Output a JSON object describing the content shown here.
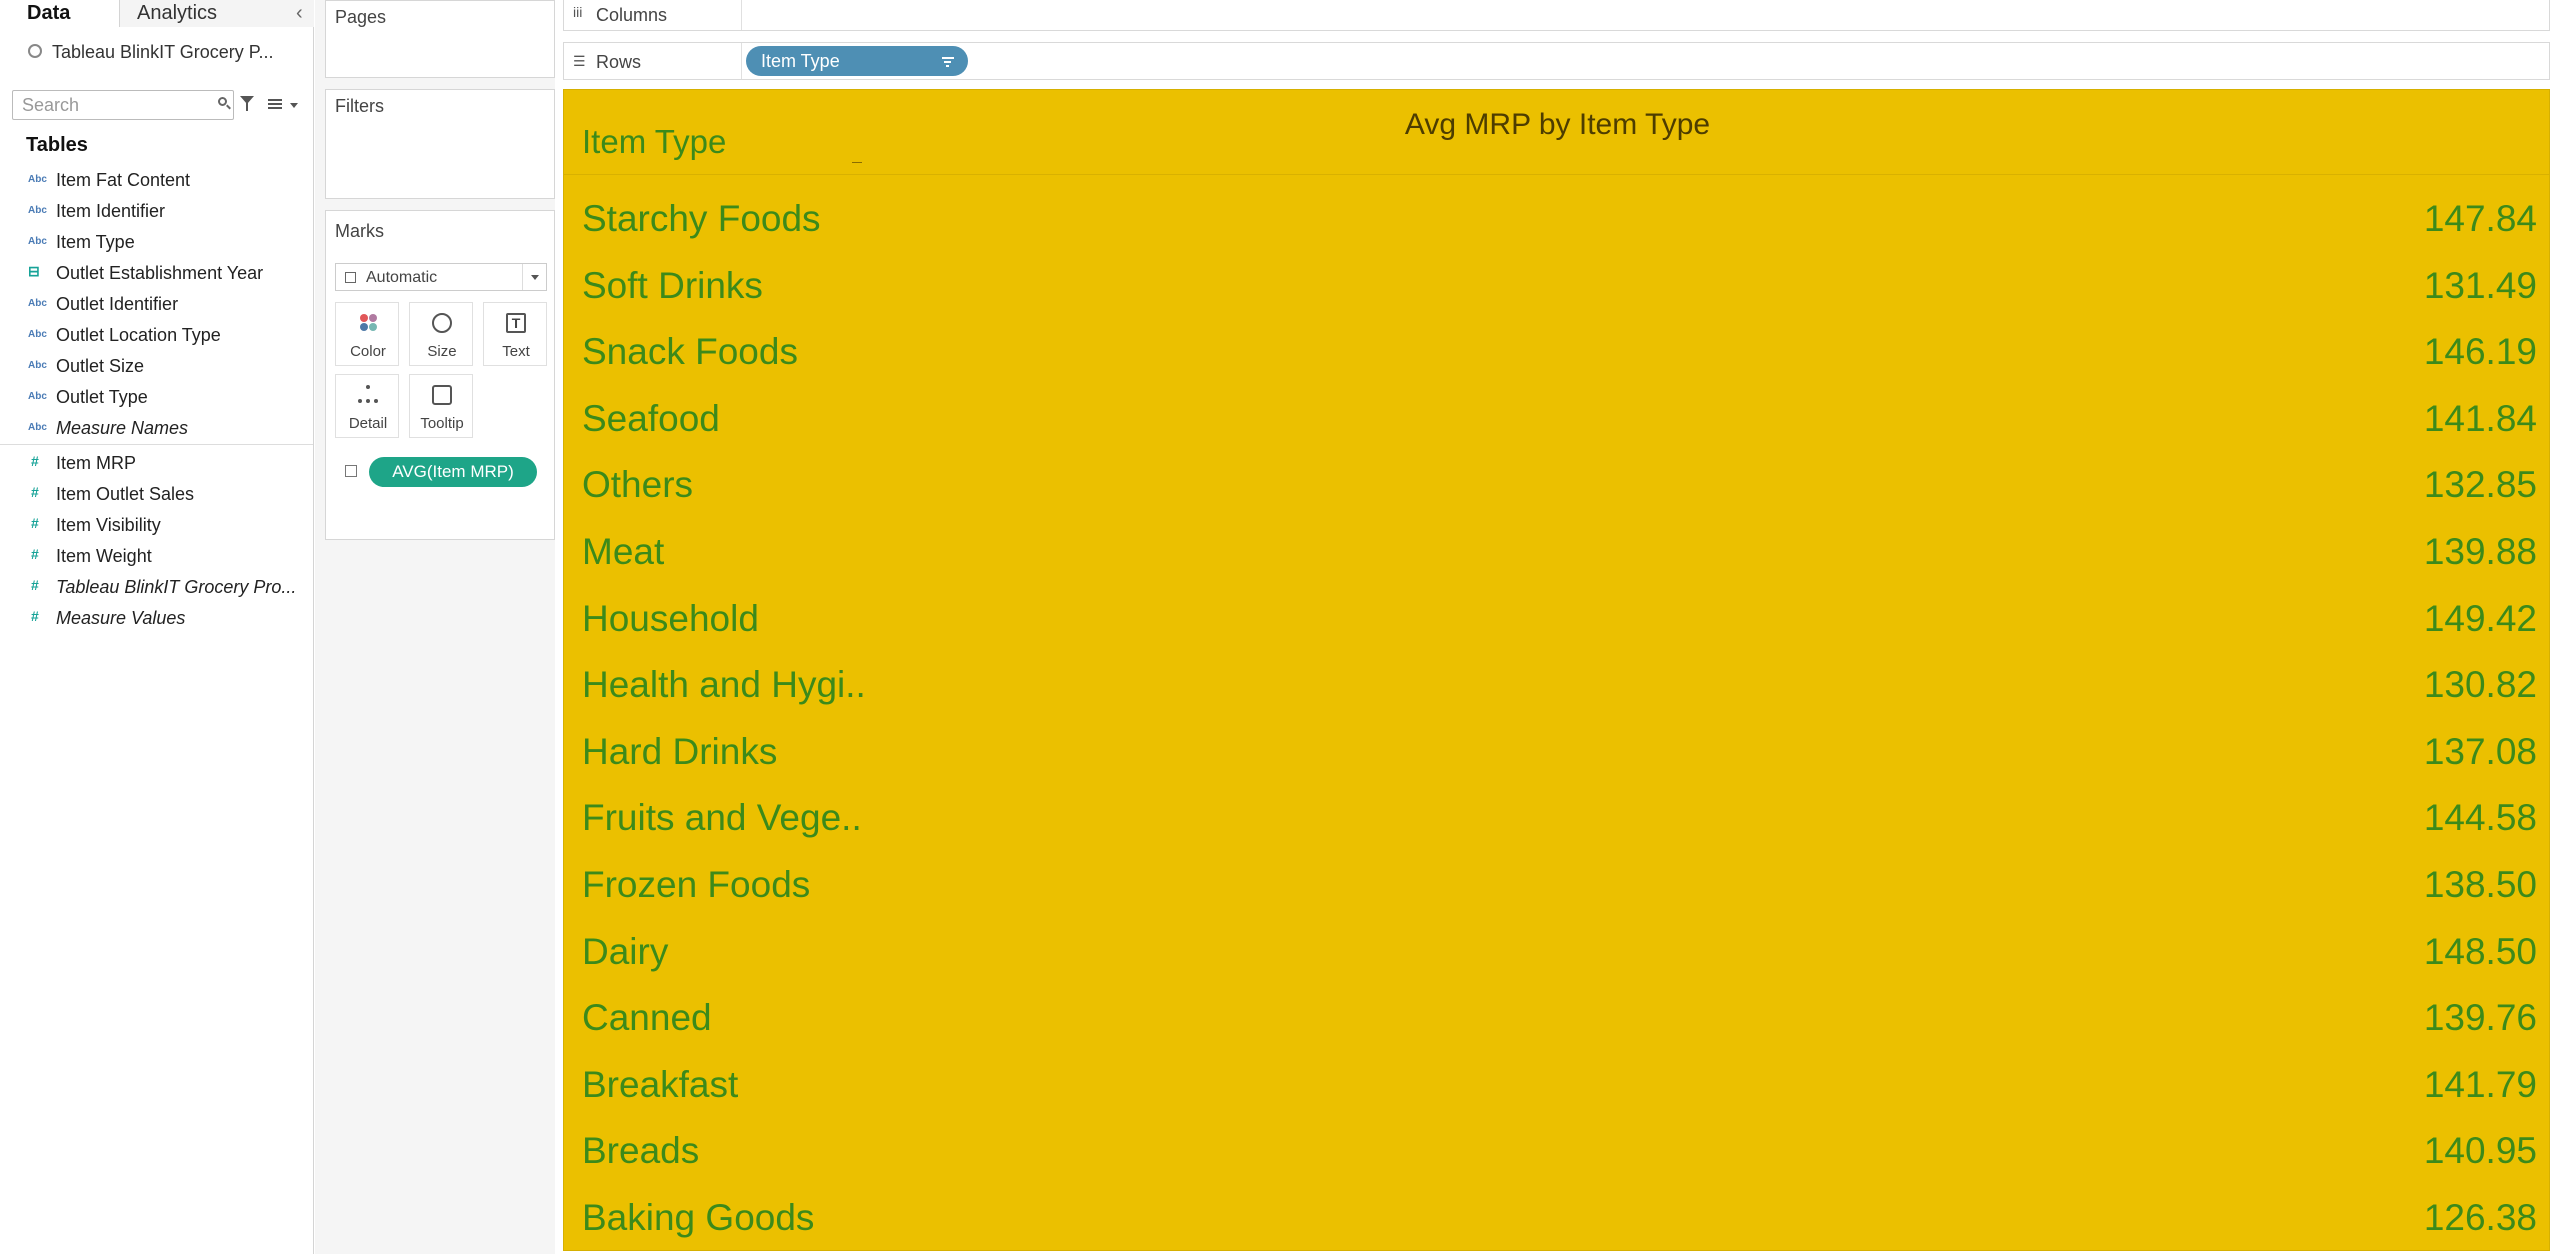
{
  "tabs": {
    "data": "Data",
    "analytics": "Analytics"
  },
  "datasource": "Tableau BlinkIT Grocery P...",
  "search": {
    "placeholder": "Search"
  },
  "tables_heading": "Tables",
  "dimensions": [
    {
      "label": "Item Fat Content",
      "icon": "Abc",
      "italic": false
    },
    {
      "label": "Item Identifier",
      "icon": "Abc",
      "italic": false
    },
    {
      "label": "Item Type",
      "icon": "Abc",
      "italic": false
    },
    {
      "label": "Outlet Establishment Year",
      "icon": "calendar-icon",
      "italic": false
    },
    {
      "label": "Outlet Identifier",
      "icon": "Abc",
      "italic": false
    },
    {
      "label": "Outlet Location Type",
      "icon": "Abc",
      "italic": false
    },
    {
      "label": "Outlet Size",
      "icon": "Abc",
      "italic": false
    },
    {
      "label": "Outlet Type",
      "icon": "Abc",
      "italic": false
    },
    {
      "label": "Measure Names",
      "icon": "Abc",
      "italic": true
    }
  ],
  "measures": [
    {
      "label": "Item MRP",
      "icon": "#",
      "italic": false
    },
    {
      "label": "Item Outlet Sales",
      "icon": "#",
      "italic": false
    },
    {
      "label": "Item Visibility",
      "icon": "#",
      "italic": false
    },
    {
      "label": "Item Weight",
      "icon": "#",
      "italic": false
    },
    {
      "label": "Tableau BlinkIT Grocery Pro...",
      "icon": "#",
      "italic": true
    },
    {
      "label": "Measure Values",
      "icon": "#",
      "italic": true
    }
  ],
  "cards": {
    "pages": "Pages",
    "filters": "Filters",
    "marks": "Marks"
  },
  "marks": {
    "type": "Automatic",
    "buttons": {
      "color": "Color",
      "size": "Size",
      "text": "Text",
      "detail": "Detail",
      "tooltip": "Tooltip"
    },
    "text_glyph": "T",
    "pill": "AVG(Item MRP)"
  },
  "shelves": {
    "columns": "Columns",
    "rows": "Rows",
    "rows_pill": "Item Type"
  },
  "colors": {
    "viz_bg": "#ebc000",
    "text_green": "#3c8a1a",
    "pill_blue": "#4e8fb4",
    "pill_green": "#1ea588"
  },
  "chart_data": {
    "type": "table",
    "title": "Avg MRP by Item Type",
    "row_header": "Item Type",
    "categories": [
      "Starchy Foods",
      "Soft Drinks",
      "Snack Foods",
      "Seafood",
      "Others",
      "Meat",
      "Household",
      "Health and Hygi..",
      "Hard Drinks",
      "Fruits and Vege..",
      "Frozen Foods",
      "Dairy",
      "Canned",
      "Breakfast",
      "Breads",
      "Baking Goods"
    ],
    "values": [
      "147.84",
      "131.49",
      "146.19",
      "141.84",
      "132.85",
      "139.88",
      "149.42",
      "130.82",
      "137.08",
      "144.58",
      "138.50",
      "148.50",
      "139.76",
      "141.79",
      "140.95",
      "126.38"
    ]
  }
}
